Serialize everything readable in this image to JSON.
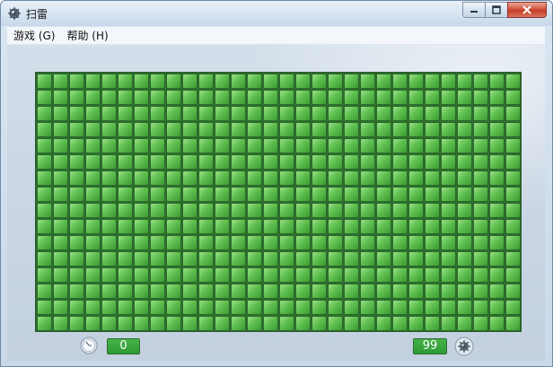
{
  "window": {
    "title": "扫雷",
    "icons": {
      "app": "minesweeper-mine-icon",
      "minimize": "minimize-icon",
      "maximize": "maximize-icon",
      "close": "close-icon"
    }
  },
  "menu": {
    "items": [
      {
        "label": "游戏 (G)"
      },
      {
        "label": "帮助 (H)"
      }
    ]
  },
  "board": {
    "columns": 30,
    "rows": 16,
    "cell_state": "unrevealed",
    "cell_color": "#5fc04f"
  },
  "status": {
    "time": "0",
    "mines_remaining": "99",
    "icons": {
      "time": "clock-icon",
      "mines": "mine-icon"
    }
  }
}
